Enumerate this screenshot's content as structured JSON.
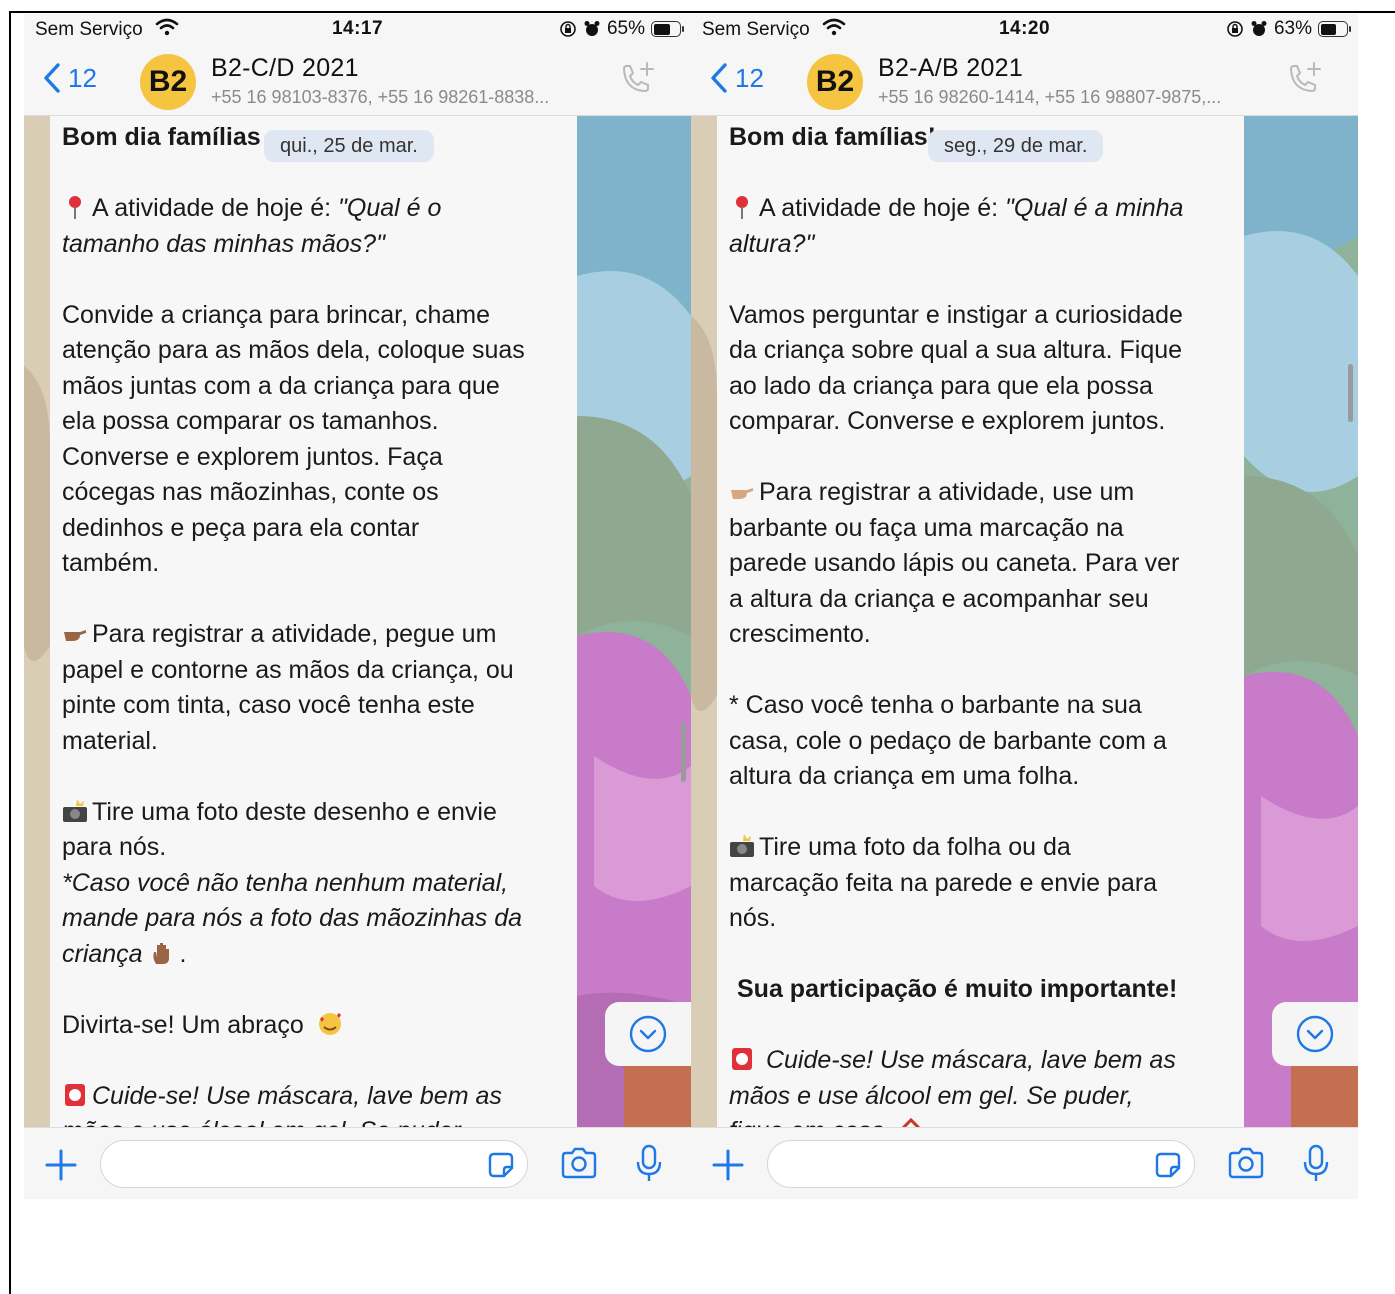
{
  "colors": {
    "accent": "#1e78e6",
    "avatar_bg": "#f5c441",
    "bubble_bg": "#f7f7f7",
    "date_chip_bg": "#dfe7f3",
    "wallpaper_green": "#8fb29a",
    "wallpaper_blue": "#8fb9d0",
    "wallpaper_pink": "#c77bc8"
  },
  "left": {
    "status": {
      "carrier": "Sem Serviço",
      "time": "14:17",
      "battery": "65%",
      "battery_level": 0.65
    },
    "header": {
      "back_count": "12",
      "avatar": "B2",
      "title": "B2-C/D 2021",
      "members": "+55 16 98103-8376, +55 16 98261-8838..."
    },
    "date_chip": "qui., 25 de mar.",
    "message": {
      "greeting": "Bom dia famílias",
      "activity_prefix": "A atividade de hoje é: ",
      "activity_line1_italic": "\"Qual é o",
      "activity_line2": "tamanho das minhas mãos?\"",
      "p1": [
        "Convide a criança para brincar, chame",
        "atenção para as mãos dela, coloque suas",
        "mãos juntas com a da criança para que",
        "ela possa comparar os tamanhos.",
        "Converse e explorem juntos. Faça",
        "cócegas nas mãozinhas, conte os",
        "dedinhos e peça para ela contar",
        "também."
      ],
      "p2_first": "Para registrar a atividade, pegue um",
      "p2": [
        "papel e contorne as mãos da criança, ou",
        "pinte com tinta, caso você tenha este",
        "material."
      ],
      "p3_first": "Tire uma foto deste desenho e envie",
      "p3_second": "para nós.",
      "p3_italic": [
        " *Caso você não tenha nenhum material,",
        "mande para nós a foto das mãozinhas da"
      ],
      "p3_last": "criança",
      "p3_end": ".",
      "p4": "Divirta-se! Um abraço",
      "p5": "Cuide-se! Use máscara, lave bem as",
      "p5_cut": "mãos e use álcool em gel. Se puder,"
    }
  },
  "right": {
    "status": {
      "carrier": "Sem Serviço",
      "time": "14:20",
      "battery": "63%",
      "battery_level": 0.63
    },
    "header": {
      "back_count": "12",
      "avatar": "B2",
      "title": "B2-A/B 2021",
      "members": "+55 16 98260-1414, +55 16 98807-9875,..."
    },
    "date_chip": "seg., 29 de mar.",
    "message": {
      "greeting": "Bom dia famílias!",
      "activity_prefix": "A atividade de hoje é: ",
      "activity_line1_italic": "\"Qual é a minha",
      "activity_line2": "altura?\"",
      "p1": [
        "Vamos perguntar e instigar a curiosidade",
        "da criança sobre qual a sua altura. Fique",
        "ao lado da criança para que ela possa",
        "comparar. Converse e explorem juntos."
      ],
      "p2_first": "Para registrar a atividade, use um",
      "p2": [
        "barbante ou faça uma marcação na",
        "parede usando lápis ou caneta. Para ver",
        "a altura da criança e acompanhar seu",
        "crescimento."
      ],
      "p3": [
        "* Caso você tenha o barbante na sua",
        "casa, cole o pedaço de barbante com a",
        "altura da criança em uma folha."
      ],
      "p4_first": "Tire uma foto da folha ou da",
      "p4": [
        "marcação feita na parede e envie para",
        "nós."
      ],
      "p5": "Sua participação é muito importante!",
      "p6_first": " Cuide-se! Use máscara, lave bem as",
      "p6_second": "mãos e use álcool em gel. Se puder,",
      "p6_cut": "fique em casa"
    }
  }
}
